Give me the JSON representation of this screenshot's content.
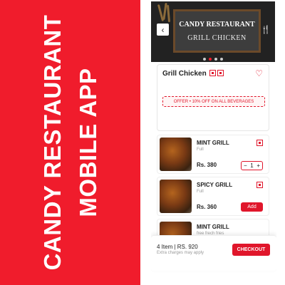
{
  "promo": {
    "line1": "CANDY RESTAURANT",
    "line2": "MOBILE APP"
  },
  "banner": {
    "board_title": "CANDY RESTAURANT",
    "board_subtitle": "GRILL CHICKEN",
    "back_icon": "‹",
    "back_icon_name": "chevron-left-icon",
    "cutlery_icon": "🍴",
    "cutlery_icon_name": "fork-knife-icon",
    "carousel_dots": 4,
    "active_dot": 2
  },
  "detail": {
    "title": "Grill Chicken",
    "favorite_icon": "♡",
    "offer_text": "OFFER • 10% OFF ON ALL BEVERAGES"
  },
  "menu_items": [
    {
      "name": "MINT GRILL",
      "subtitle": "Full",
      "price": "Rs. 380",
      "action": "stepper",
      "quantity": "1",
      "minus": "−",
      "plus": "+"
    },
    {
      "name": "SPICY GRILL",
      "subtitle": "Full",
      "price": "Rs. 360",
      "action": "add",
      "add_label": "Add"
    },
    {
      "name": "MINT GRILL",
      "subtitle": "free frech fries"
    }
  ],
  "cart": {
    "summary": "4 Item | RS. 920",
    "note": "Extra charges may apply",
    "checkout_label": "CHECKOUT"
  },
  "colors": {
    "brand_red": "#f01c2c",
    "accent_red": "#e0162b"
  }
}
